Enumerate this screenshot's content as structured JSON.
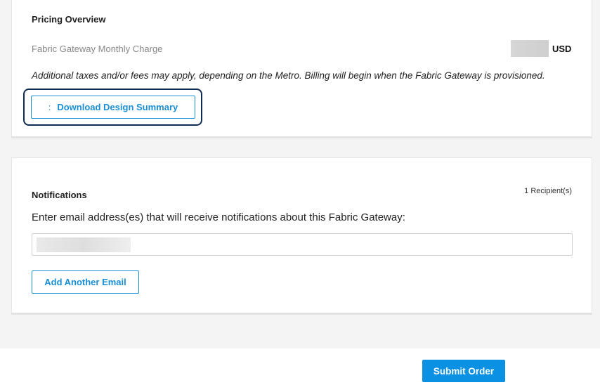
{
  "pricing": {
    "title": "Pricing Overview",
    "charge_label": "Fabric Gateway Monthly Charge",
    "currency": "USD",
    "note": "Additional taxes and/or fees may apply, depending on the Metro. Billing will begin when the Fabric Gateway is provisioned.",
    "download_icon": ":",
    "download_label": "Download Design Summary"
  },
  "notifications": {
    "title": "Notifications",
    "recipients": "1 Recipient(s)",
    "instruction": "Enter email address(es) that will receive notifications about this Fabric Gateway:",
    "add_email_label": "Add Another Email"
  },
  "footer": {
    "submit_label": "Submit Order"
  }
}
